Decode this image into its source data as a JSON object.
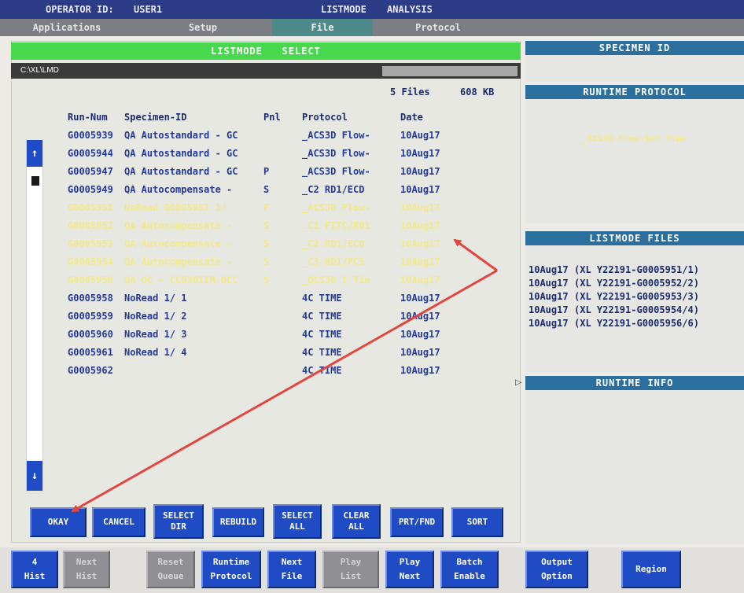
{
  "topbar": {
    "operator_label": "OPERATOR ID:",
    "operator_value": "USER1",
    "mode_label": "LISTMODE",
    "mode_value": "ANALYSIS"
  },
  "menu": {
    "applications": "Applications",
    "setup": "Setup",
    "file": "File",
    "protocol": "Protocol"
  },
  "dialog": {
    "title": "LISTMODE   SELECT",
    "path": "C:\\XL\\LMD",
    "files_count": "5 Files",
    "files_size": "608 KB",
    "columns": {
      "run": "Run-Num",
      "specimen": "Specimen-ID",
      "pnl": "Pnl",
      "protocol": "Protocol",
      "date": "Date"
    },
    "rows": [
      {
        "run": "G0005939",
        "specimen": "QA Autostandard - GC",
        "pnl": "",
        "protocol": "_ACS3D Flow-",
        "date": "10Aug17",
        "selected": false
      },
      {
        "run": "G0005944",
        "specimen": "QA Autostandard - GC",
        "pnl": "",
        "protocol": "_ACS3D Flow-",
        "date": "10Aug17",
        "selected": false
      },
      {
        "run": "G0005947",
        "specimen": "QA Autostandard - GC",
        "pnl": "P",
        "protocol": "_ACS3D Flow-",
        "date": "10Aug17",
        "selected": false
      },
      {
        "run": "G0005949",
        "specimen": "QA Autocompensate -",
        "pnl": "S",
        "protocol": "_C2 RD1/ECD",
        "date": "10Aug17",
        "selected": false
      },
      {
        "run": "G0005951",
        "specimen": "NoRead G0005951 1/",
        "pnl": "P",
        "protocol": "_ACS3D Flow-",
        "date": "10Aug17",
        "selected": true
      },
      {
        "run": "G0005952",
        "specimen": "QA Autocompensate -",
        "pnl": "S",
        "protocol": "_C1 FITC/RD1",
        "date": "10Aug17",
        "selected": true
      },
      {
        "run": "G0005953",
        "specimen": "QA Autocompensate -",
        "pnl": "S",
        "protocol": "_C2 RD1/ECD",
        "date": "10Aug17",
        "selected": true
      },
      {
        "run": "G0005954",
        "specimen": "QA Autocompensate -",
        "pnl": "S",
        "protocol": "_C3 RD1/PC5",
        "date": "10Aug17",
        "selected": true
      },
      {
        "run": "G0005956",
        "specimen": "QA QC - CC0301IM.QCC",
        "pnl": "S",
        "protocol": "_QCS3D 1 Tim",
        "date": "10Aug17",
        "selected": true
      },
      {
        "run": "G0005958",
        "specimen": "NoRead 1/ 1",
        "pnl": "",
        "protocol": "4C TIME",
        "date": "10Aug17",
        "selected": false
      },
      {
        "run": "G0005959",
        "specimen": "NoRead 1/ 2",
        "pnl": "",
        "protocol": "4C TIME",
        "date": "10Aug17",
        "selected": false
      },
      {
        "run": "G0005960",
        "specimen": "NoRead 1/ 3",
        "pnl": "",
        "protocol": "4C TIME",
        "date": "10Aug17",
        "selected": false
      },
      {
        "run": "G0005961",
        "specimen": "NoRead 1/ 4",
        "pnl": "",
        "protocol": "4C TIME",
        "date": "10Aug17",
        "selected": false
      },
      {
        "run": "G0005962",
        "specimen": "",
        "pnl": "",
        "protocol": "4C TIME",
        "date": "10Aug17",
        "selected": false
      }
    ],
    "scroll_up": "↑",
    "scroll_down": "↓",
    "buttons": {
      "okay": "OKAY",
      "cancel": "CANCEL",
      "select_dir_1": "SELECT",
      "select_dir_2": "DIR",
      "rebuild": "REBUILD",
      "select_all_1": "SELECT",
      "select_all_2": "ALL",
      "clear_all_1": "CLEAR",
      "clear_all_2": "ALL",
      "prt_fnd": "PRT/FND",
      "sort": "SORT"
    }
  },
  "right": {
    "specimen_id_title": "SPECIMEN ID",
    "runtime_protocol_title": "RUNTIME PROTOCOL",
    "runtime_protocol_value": "_ACS3D Flow-Set Time",
    "listmode_files_title": "LISTMODE FILES",
    "listmode_files": [
      {
        "date": "10Aug17",
        "name": "(XL Y22191-G0005951/1)"
      },
      {
        "date": "10Aug17",
        "name": "(XL Y22191-G0005952/2)"
      },
      {
        "date": "10Aug17",
        "name": "(XL Y22191-G0005953/3)"
      },
      {
        "date": "10Aug17",
        "name": "(XL Y22191-G0005954/4)"
      },
      {
        "date": "10Aug17",
        "name": "(XL Y22191-G0005956/6)"
      }
    ],
    "runtime_info_title": "RUNTIME INFO"
  },
  "bottom": {
    "hist4_1": "4",
    "hist4_2": "Hist",
    "next_hist_1": "Next",
    "next_hist_2": "Hist",
    "reset_queue_1": "Reset",
    "reset_queue_2": "Queue",
    "runtime_protocol_1": "Runtime",
    "runtime_protocol_2": "Protocol",
    "next_file_1": "Next",
    "next_file_2": "File",
    "play_list_1": "Play",
    "play_list_2": "List",
    "play_next_1": "Play",
    "play_next_2": "Next",
    "batch_enable_1": "Batch",
    "batch_enable_2": "Enable",
    "output_option_1": "Output",
    "output_option_2": "Option",
    "region": "Region"
  },
  "colors": {
    "accent_blue": "#1f4cc4",
    "title_green": "#47d84e",
    "selected_text": "#f3e98a",
    "annotation_red": "#e2463e"
  }
}
